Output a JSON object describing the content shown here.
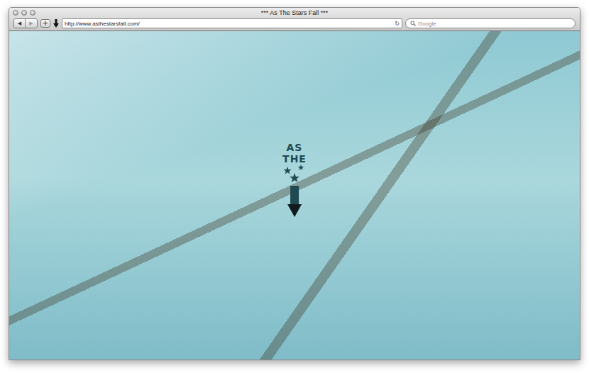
{
  "window": {
    "title": "*** As The Stars Fall ***"
  },
  "toolbar": {
    "nav": [
      {
        "label": "◀",
        "disabled": false
      },
      {
        "label": "▶",
        "disabled": true
      }
    ],
    "add": "+",
    "url": "http://www.asthestarsfall.com/",
    "reload": "↻",
    "search": {
      "placeholder": "Google"
    }
  },
  "logo": {
    "lines": [
      "AS",
      "THE"
    ]
  }
}
